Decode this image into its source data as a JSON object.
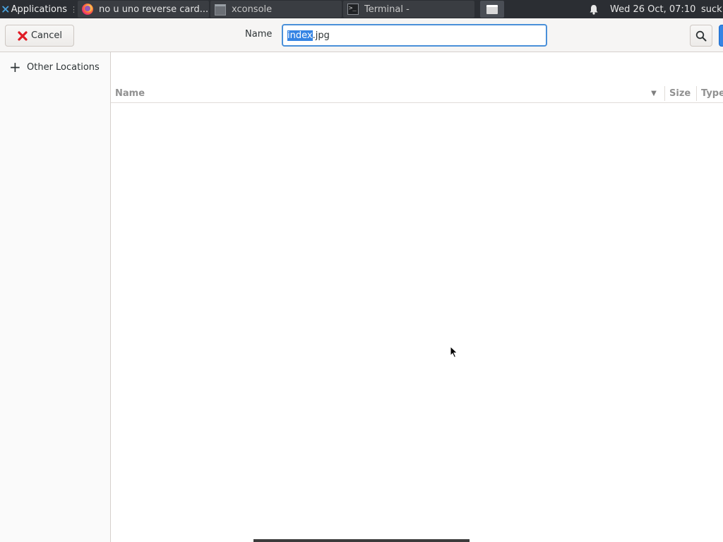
{
  "taskbar": {
    "apps_label": "Applications",
    "apps_sep": "⋮",
    "tasks": [
      {
        "title": "no u uno reverse card...",
        "icon": "firefox-icon"
      },
      {
        "title": "xconsole",
        "icon": "window-icon"
      },
      {
        "title": "Terminal -",
        "icon": "terminal-icon"
      }
    ],
    "clock": "Wed 26 Oct, 07:10",
    "user": "suck"
  },
  "dialog": {
    "cancel_label": "Cancel",
    "name_label": "Name",
    "filename_selected": "index",
    "filename_rest": ".jpg"
  },
  "sidebar": {
    "items": [
      {
        "label": "Other Locations",
        "icon": "plus-icon"
      }
    ]
  },
  "file_list": {
    "columns": [
      "Name",
      "Size",
      "Type"
    ],
    "rows": []
  },
  "colors": {
    "accent": "#3584e4",
    "panel_bg": "#2b2e33",
    "header_bg": "#f6f5f4",
    "cancel_icon": "#e01b24"
  }
}
